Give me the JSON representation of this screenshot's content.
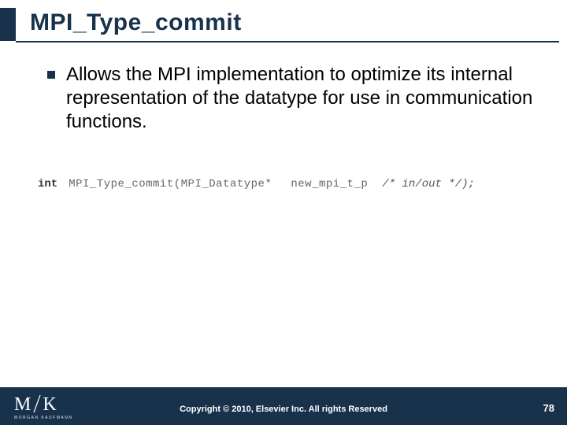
{
  "title": "MPI_Type_commit",
  "bullets": [
    "Allows the MPI implementation to optimize its internal representation of the datatype for use in communication functions."
  ],
  "code": {
    "return_kw": "int",
    "signature": "MPI_Type_commit(MPI_Datatype*",
    "param": "new_mpi_t_p",
    "comment": "/*  in/out  */);"
  },
  "footer": {
    "logo_main": "M",
    "logo_main2": "K",
    "logo_sub": "MORGAN KAUFMANN",
    "copyright": "Copyright © 2010, Elsevier Inc. All rights Reserved",
    "page": "78"
  }
}
